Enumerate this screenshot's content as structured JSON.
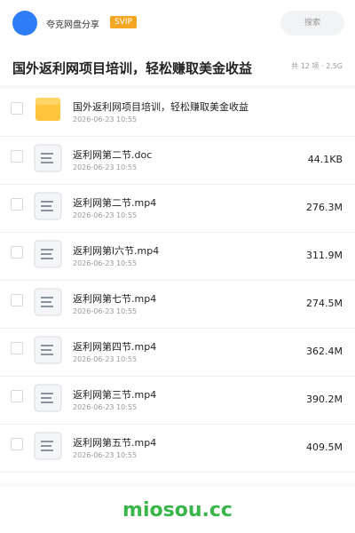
{
  "header": {
    "brand": "夸克网盘分享",
    "badge": "SVIP",
    "search_placeholder": "搜索"
  },
  "folder": {
    "title": "国外返利网项目培训，轻松赚取美金收益",
    "meta": "共 12 项 · 2.5G"
  },
  "files": [
    {
      "name": "国外返利网项目培训，轻松赚取美金收益",
      "date": "2026-06-23 10:55",
      "size": "",
      "type": "folder"
    },
    {
      "name": "返利网第二节.doc",
      "date": "2026-06-23 10:55",
      "size": "44.1KB",
      "type": "doc"
    },
    {
      "name": "返利网第二节.mp4",
      "date": "2026-06-23 10:55",
      "size": "276.3M",
      "type": "doc"
    },
    {
      "name": "返利网第l六节.mp4",
      "date": "2026-06-23 10:55",
      "size": "311.9M",
      "type": "doc"
    },
    {
      "name": "返利网第七节.mp4",
      "date": "2026-06-23 10:55",
      "size": "274.5M",
      "type": "doc"
    },
    {
      "name": "返利网第四节.mp4",
      "date": "2026-06-23 10:55",
      "size": "362.4M",
      "type": "doc"
    },
    {
      "name": "返利网第三节.mp4",
      "date": "2026-06-23 10:55",
      "size": "390.2M",
      "type": "doc"
    },
    {
      "name": "返利网第五节.mp4",
      "date": "2026-06-23 10:55",
      "size": "409.5M",
      "type": "doc"
    }
  ],
  "footer": {
    "watermark": "miosou.cc"
  },
  "colors": {
    "accent": "#2f7df6",
    "badge": "#f5a623",
    "folder": "#ffc53d",
    "watermark": "#39b54a"
  }
}
